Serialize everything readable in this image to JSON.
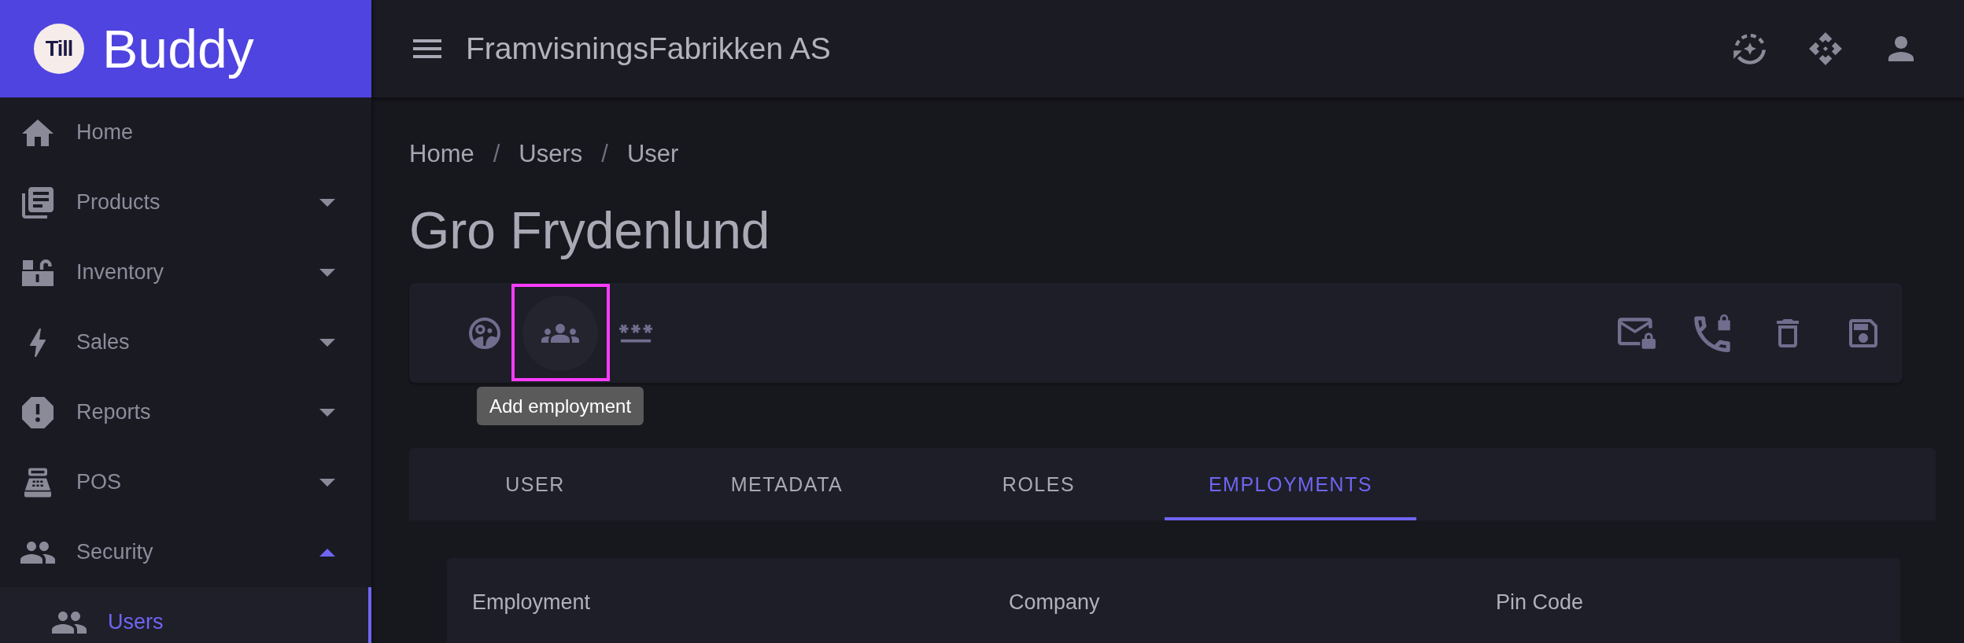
{
  "sidebar": {
    "logo": "Till",
    "brand": "Buddy",
    "items": [
      {
        "label": "Home",
        "kind": "link",
        "selected": false
      },
      {
        "label": "Products",
        "kind": "group",
        "expanded": false,
        "selected": false
      },
      {
        "label": "Inventory",
        "kind": "group",
        "expanded": false,
        "selected": false
      },
      {
        "label": "Sales",
        "kind": "group",
        "expanded": false,
        "selected": false
      },
      {
        "label": "Reports",
        "kind": "group",
        "expanded": false,
        "selected": false
      },
      {
        "label": "POS",
        "kind": "group",
        "expanded": false,
        "selected": false
      },
      {
        "label": "Security",
        "kind": "group",
        "expanded": true,
        "selected": false,
        "children": [
          {
            "label": "Users",
            "selected": true
          }
        ]
      }
    ]
  },
  "topbar": {
    "title": "FramvisningsFabrikken AS"
  },
  "breadcrumbs": [
    {
      "label": "Home",
      "kind": "link"
    },
    {
      "label": "/",
      "kind": "divider"
    },
    {
      "label": "Users",
      "kind": "link"
    },
    {
      "label": "/",
      "kind": "divider"
    },
    {
      "label": "User",
      "kind": "current"
    }
  ],
  "page_title": "Gro Frydenlund",
  "toolbar": {
    "left_actions": [
      {
        "hovered": false
      },
      {
        "hovered": true,
        "tooltip": "Add employment"
      },
      {
        "hovered": false
      }
    ]
  },
  "tabs": [
    {
      "label": "USER",
      "selected": false
    },
    {
      "label": "METADATA",
      "selected": false
    },
    {
      "label": "ROLES",
      "selected": false
    },
    {
      "label": "EMPLOYMENTS",
      "selected": true
    }
  ],
  "table": {
    "columns": [
      "Employment",
      "Company",
      "Pin Code"
    ]
  }
}
